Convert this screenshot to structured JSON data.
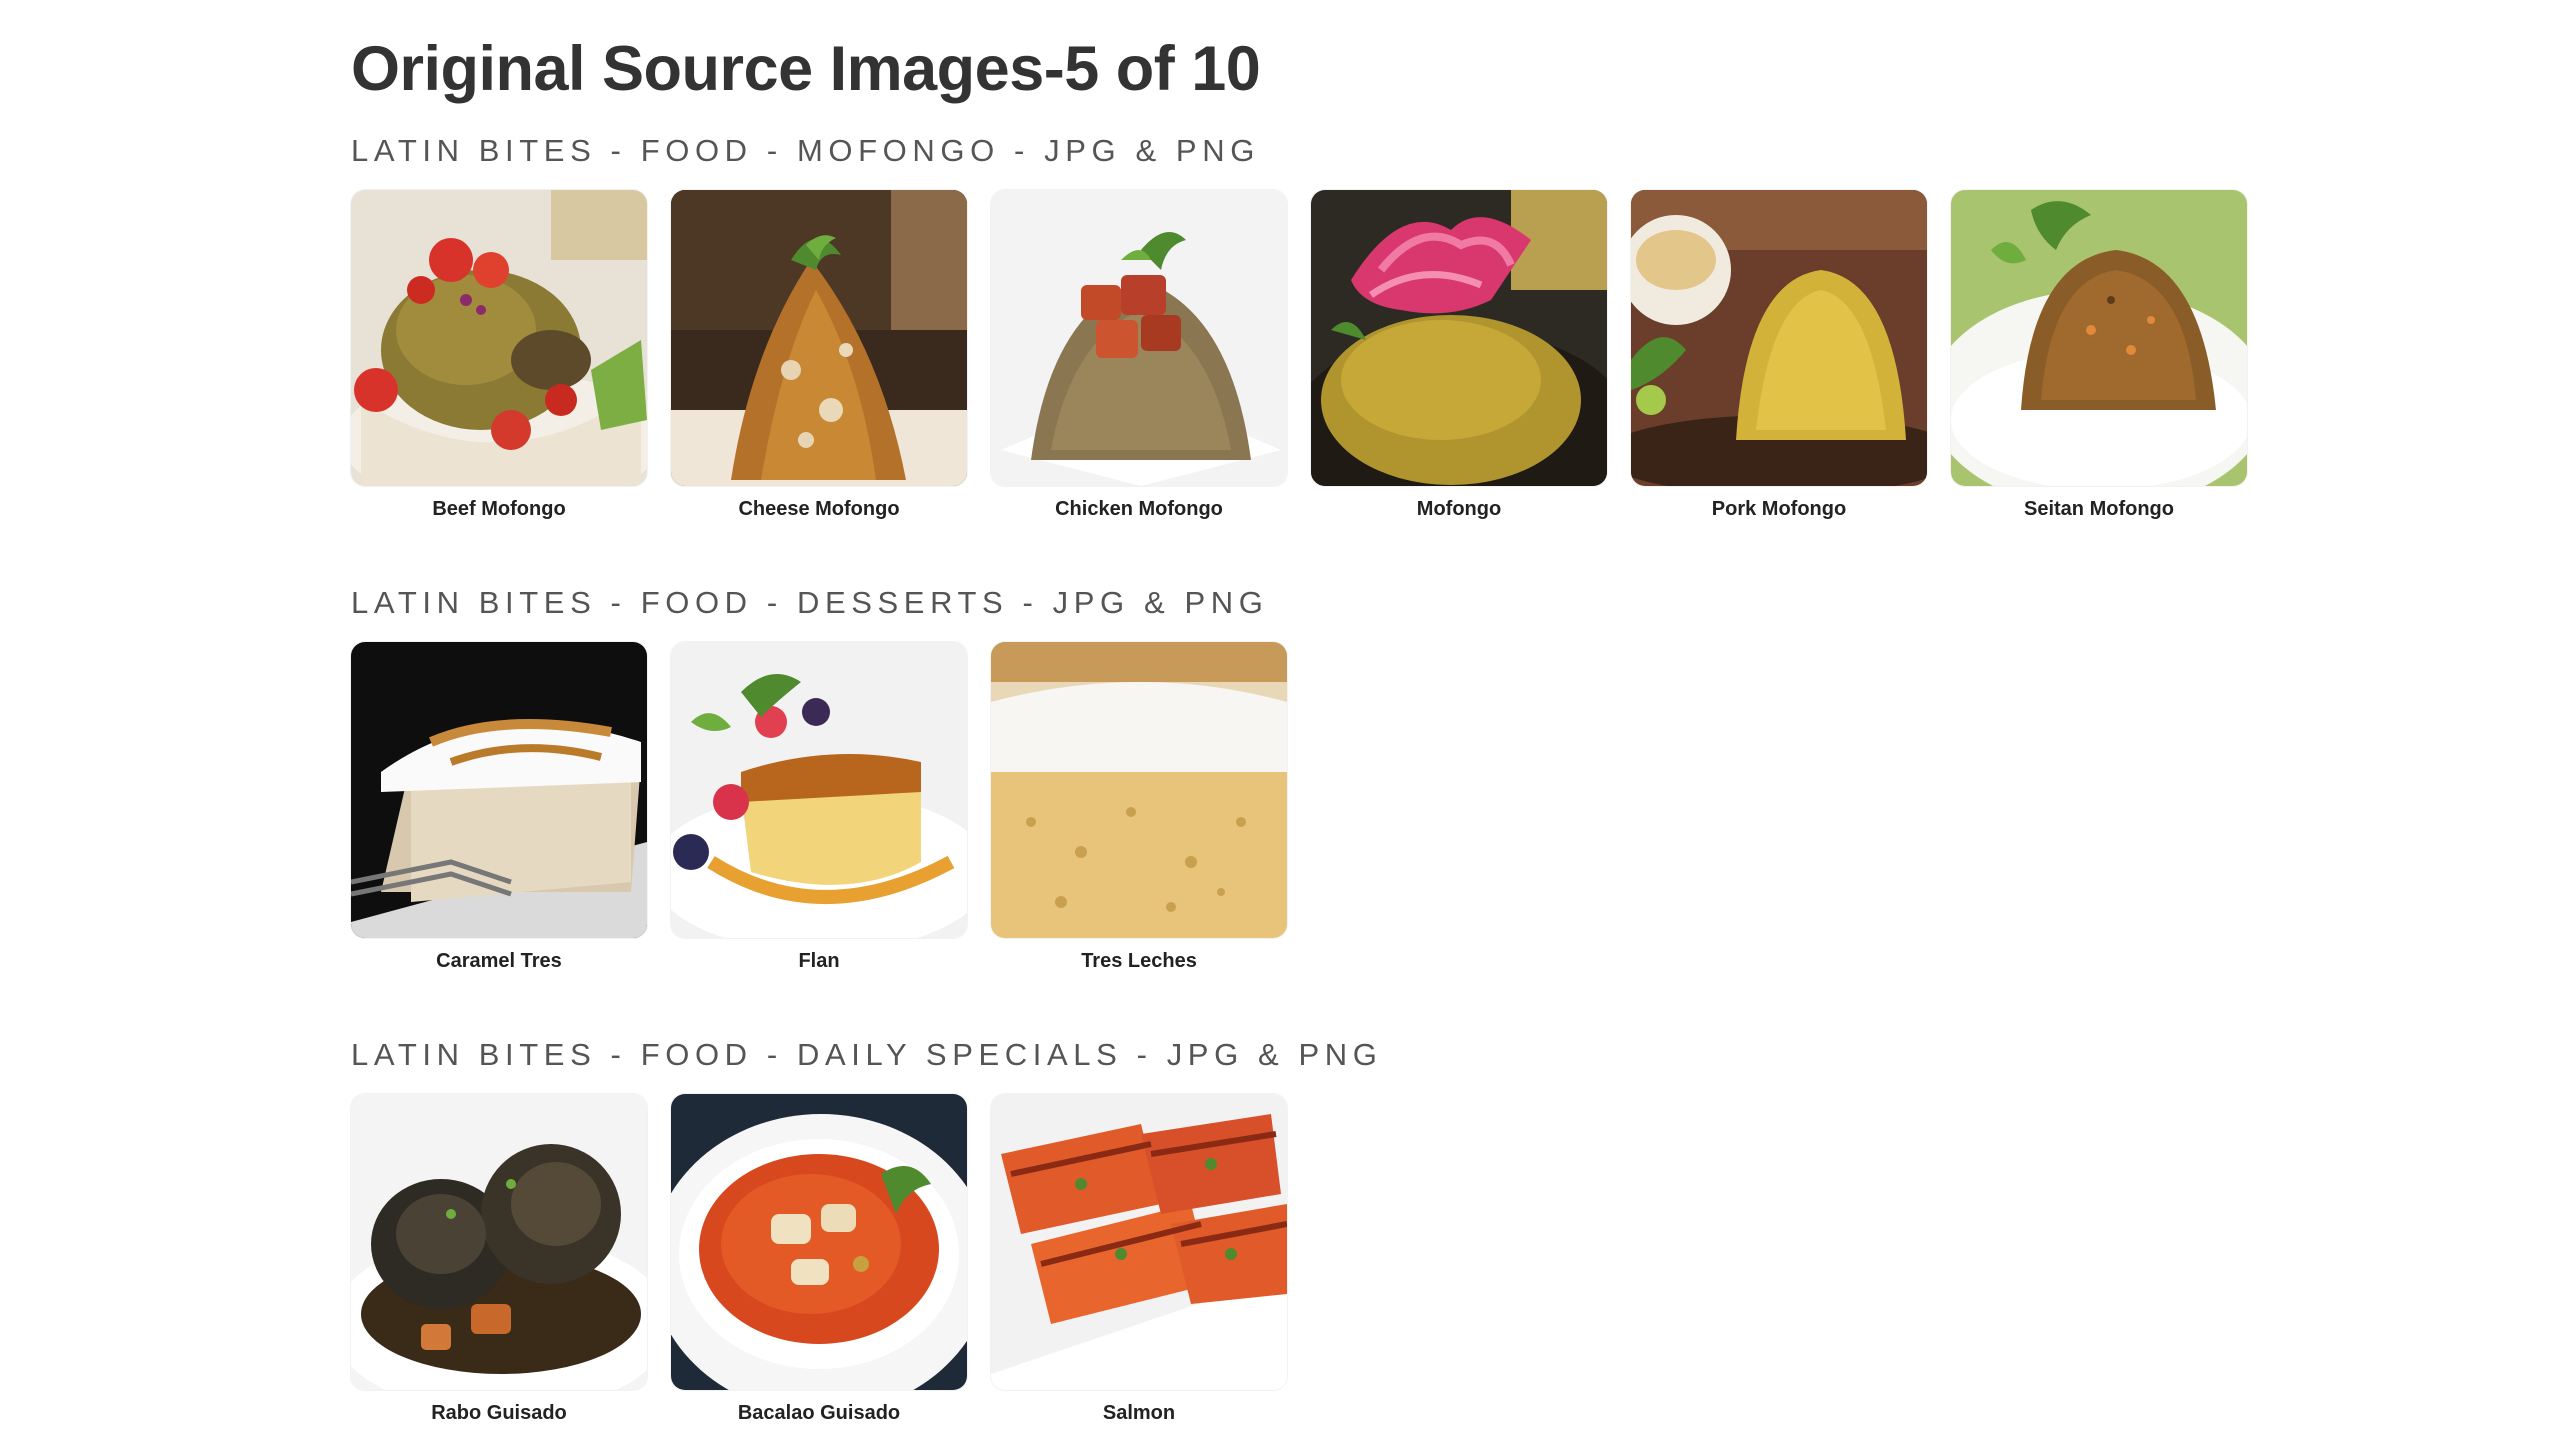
{
  "page": {
    "title": "Original Source Images-5 of 10"
  },
  "sections": [
    {
      "title": "LATIN BITES - FOOD - MOFONGO - JPG & PNG",
      "items": [
        {
          "caption": "Beef Mofongo",
          "icon": "beef-mofongo-photo"
        },
        {
          "caption": "Cheese Mofongo",
          "icon": "cheese-mofongo-photo"
        },
        {
          "caption": "Chicken Mofongo",
          "icon": "chicken-mofongo-photo"
        },
        {
          "caption": "Mofongo",
          "icon": "mofongo-photo"
        },
        {
          "caption": "Pork Mofongo",
          "icon": "pork-mofongo-photo"
        },
        {
          "caption": "Seitan Mofongo",
          "icon": "seitan-mofongo-photo"
        }
      ]
    },
    {
      "title": "LATIN BITES - FOOD - DESSERTS - JPG & PNG",
      "items": [
        {
          "caption": "Caramel Tres",
          "icon": "caramel-tres-photo"
        },
        {
          "caption": "Flan",
          "icon": "flan-photo"
        },
        {
          "caption": "Tres Leches",
          "icon": "tres-leches-photo"
        }
      ]
    },
    {
      "title": "LATIN BITES - FOOD - DAILY SPECIALS - JPG & PNG",
      "items": [
        {
          "caption": "Rabo Guisado",
          "icon": "rabo-guisado-photo"
        },
        {
          "caption": "Bacalao Guisado",
          "icon": "bacalao-guisado-photo"
        },
        {
          "caption": "Salmon",
          "icon": "salmon-photo"
        }
      ]
    }
  ],
  "colors": {
    "title_text": "#333333",
    "section_text": "#555555",
    "caption_text": "#222222",
    "background": "#ffffff"
  }
}
